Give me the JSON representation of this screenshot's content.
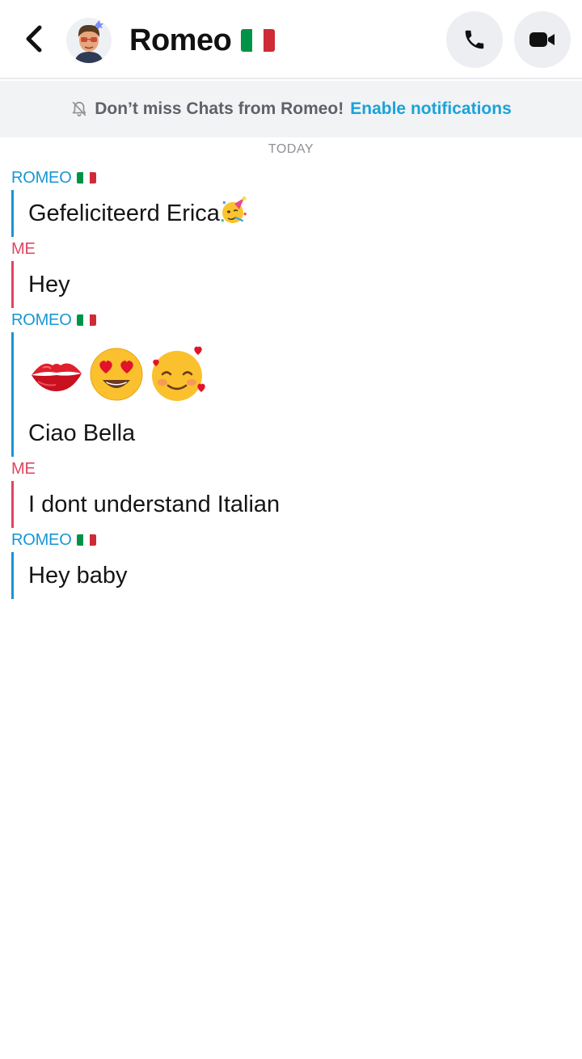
{
  "header": {
    "title": "Romeo",
    "title_flag": "italy-flag",
    "back_icon": "chevron-left-icon",
    "call_icon": "phone-icon",
    "video_icon": "video-camera-icon"
  },
  "banner": {
    "text": "Don’t miss Chats from Romeo!",
    "link": "Enable notifications",
    "icon": "bell-off-icon"
  },
  "chat": {
    "day_label": "TODAY",
    "sender_romeo": "ROMEO",
    "sender_me": "ME",
    "messages": [
      "Gefeliciteerd Erica",
      "Hey",
      "Ciao Bella",
      "I dont understand Italian",
      "Hey baby"
    ],
    "emojis": [
      "lips-emoji",
      "heart-eyes-emoji",
      "smiling-face-with-hearts-emoji"
    ]
  },
  "colors": {
    "romeo": "#1796d3",
    "me": "#e1455f",
    "link": "#1aa3d9"
  }
}
